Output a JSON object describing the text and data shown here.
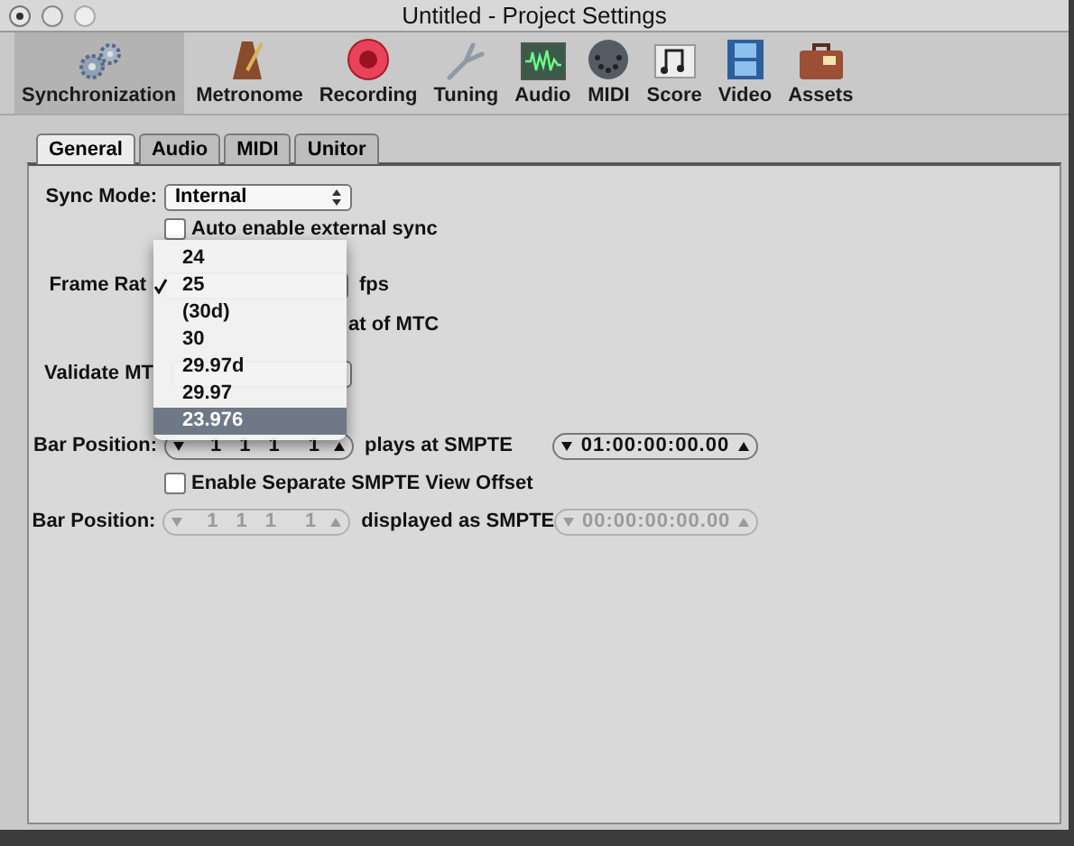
{
  "window": {
    "title": "Untitled - Project Settings"
  },
  "toolbar": {
    "items": [
      {
        "label": "Synchronization",
        "kind": "gears",
        "selected": true
      },
      {
        "label": "Metronome",
        "kind": "metronome",
        "selected": false
      },
      {
        "label": "Recording",
        "kind": "record",
        "selected": false
      },
      {
        "label": "Tuning",
        "kind": "fork",
        "selected": false
      },
      {
        "label": "Audio",
        "kind": "wave",
        "selected": false
      },
      {
        "label": "MIDI",
        "kind": "midi",
        "selected": false
      },
      {
        "label": "Score",
        "kind": "score",
        "selected": false
      },
      {
        "label": "Video",
        "kind": "film",
        "selected": false
      },
      {
        "label": "Assets",
        "kind": "case",
        "selected": false
      }
    ]
  },
  "tabs": [
    {
      "label": "General",
      "selected": true
    },
    {
      "label": "Audio",
      "selected": false
    },
    {
      "label": "MIDI",
      "selected": false
    },
    {
      "label": "Unitor",
      "selected": false
    }
  ],
  "form": {
    "sync_mode": {
      "label": "Sync Mode:",
      "value": "Internal"
    },
    "auto_enable": {
      "label": "Auto enable external sync",
      "checked": false
    },
    "frame_rate": {
      "label": "Frame Rat",
      "unit": "fps"
    },
    "auto_detect": {
      "label": "at of MTC"
    },
    "validate": {
      "label": "Validate MT"
    },
    "bar_position_1": {
      "label": "Bar Position:",
      "values": [
        "1",
        "1",
        "1",
        "1"
      ],
      "disabled": false,
      "caption": "plays at SMPTE",
      "smpte": "01:00:00:00.00"
    },
    "enable_offset": {
      "label": "Enable Separate SMPTE View Offset",
      "checked": false
    },
    "bar_position_2": {
      "label": "Bar Position:",
      "values": [
        "1",
        "1",
        "1",
        "1"
      ],
      "disabled": true,
      "caption": "displayed as SMPTE",
      "smpte": "00:00:00:00.00"
    }
  },
  "menu": {
    "items": [
      {
        "label": "24",
        "checked": false,
        "selected": false
      },
      {
        "label": "25",
        "checked": true,
        "selected": false
      },
      {
        "label": "(30d)",
        "checked": false,
        "selected": false
      },
      {
        "label": "30",
        "checked": false,
        "selected": false
      },
      {
        "label": "29.97d",
        "checked": false,
        "selected": false
      },
      {
        "label": "29.97",
        "checked": false,
        "selected": false
      },
      {
        "label": "23.976",
        "checked": false,
        "selected": true
      }
    ]
  }
}
